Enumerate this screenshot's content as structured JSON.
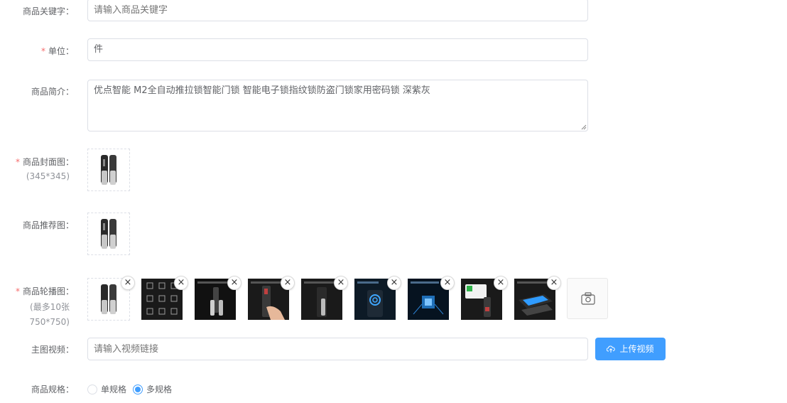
{
  "keyword": {
    "label": "商品关键字：",
    "placeholder": "请输入商品关键字",
    "value": ""
  },
  "unit": {
    "required_mark": "*",
    "label": "单位：",
    "value": "件"
  },
  "intro": {
    "label": "商品简介：",
    "value": "优点智能 M2全自动推拉锁智能门锁 智能电子锁指纹锁防盗门锁家用密码锁 深紫灰"
  },
  "cover": {
    "required_mark": "*",
    "label": "商品封面图：",
    "hint": "(345*345)"
  },
  "recommend": {
    "label": "商品推荐图："
  },
  "carousel": {
    "required_mark": "*",
    "label": "商品轮播图：",
    "hint_line1": "(最多10张",
    "hint_line2": "750*750)",
    "close_symbol": "×",
    "image_count": 9
  },
  "video": {
    "label": "主图视频：",
    "placeholder": "请输入视频链接",
    "upload_label": "上传视频"
  },
  "spec": {
    "label": "商品规格：",
    "options": [
      "单规格",
      "多规格"
    ],
    "selected": "多规格"
  },
  "colors": {
    "primary": "#409eff",
    "required": "#f56c6c",
    "border": "#dcdfe6"
  },
  "icons": {
    "upload": "cloud-upload-icon",
    "camera": "camera-icon",
    "close": "close-icon"
  }
}
